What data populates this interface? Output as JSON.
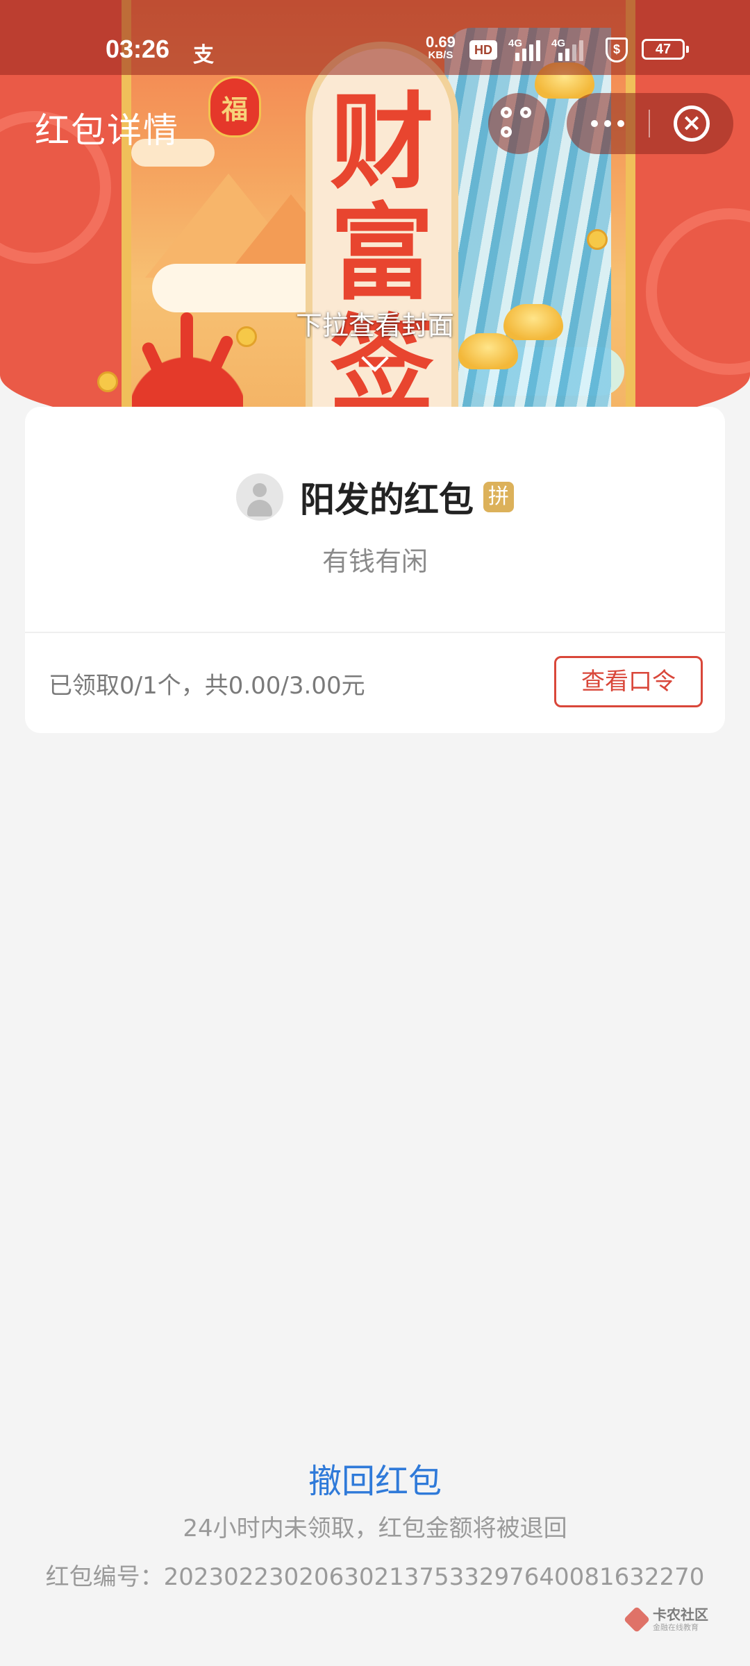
{
  "status_bar": {
    "time": "03:26",
    "app_glyph": "支",
    "net_speed": "0.69",
    "net_speed_unit": "KB/S",
    "hd_label": "HD",
    "sim1_type": "4G",
    "sim2_type": "4G",
    "shield_symbol": "$",
    "battery": "47"
  },
  "header": {
    "title": "红包详情",
    "scan_icon": "scan-icon",
    "more_icon": "more-dots-icon",
    "close_icon": "close-circle-icon"
  },
  "cover": {
    "chars": [
      "财",
      "富",
      "签"
    ],
    "lucky_bag": "福",
    "pull_hint": "下拉查看封面",
    "colors": {
      "banner": "#ea5a47",
      "gold": "#f0c05a",
      "red": "#e8452f"
    }
  },
  "card": {
    "sender_name": "阳发的红包",
    "type_badge": "拼",
    "greeting": "有钱有闲",
    "claim_status": "已领取0/1个，共0.00/3.00元",
    "view_code_button": "查看口令"
  },
  "footer": {
    "withdraw_link": "撤回红包",
    "withdraw_note": "24小时内未领取，红包金额将被退回",
    "packet_id": "红包编号：20230223020630213753329764008163​2270",
    "watermark_title": "卡农社区",
    "watermark_sub": "金融在线教育"
  },
  "colors": {
    "accent_red": "#d9473a",
    "link_blue": "#2f7ad9",
    "badge_gold": "#dcb15a",
    "page_bg": "#f4f4f4"
  }
}
